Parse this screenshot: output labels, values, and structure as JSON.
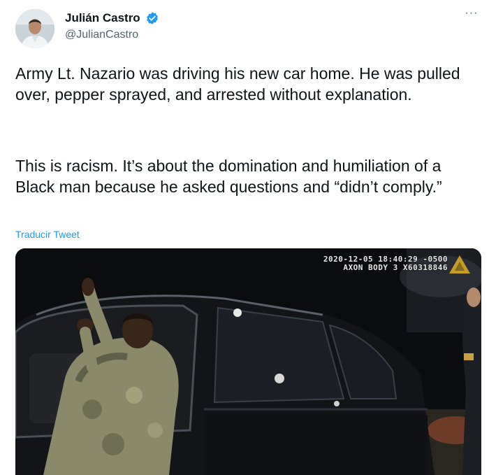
{
  "author": {
    "name": "Julián Castro",
    "handle": "@JulianCastro",
    "verified_icon": "verified-badge-icon",
    "avatar_icon": "profile-photo"
  },
  "menu": {
    "more_label": "···"
  },
  "tweet": {
    "paragraph_1": "Army Lt. Nazario was driving his new car home. He was pulled over, pepper sprayed, and arrested without explanation.",
    "paragraph_2": "This is racism. It’s about the domination and humiliation of a Black man because he asked questions and “didn’t comply.”",
    "translate_link": "Traducir Tweet"
  },
  "media": {
    "camera_timestamp": "2020-12-05 18:40:29 -0500",
    "camera_device": "AXON BODY 3 X60318846"
  },
  "colors": {
    "text": "#0f1419",
    "muted": "#536471",
    "link": "#1d9bf0",
    "verified": "#1d9bf0"
  }
}
